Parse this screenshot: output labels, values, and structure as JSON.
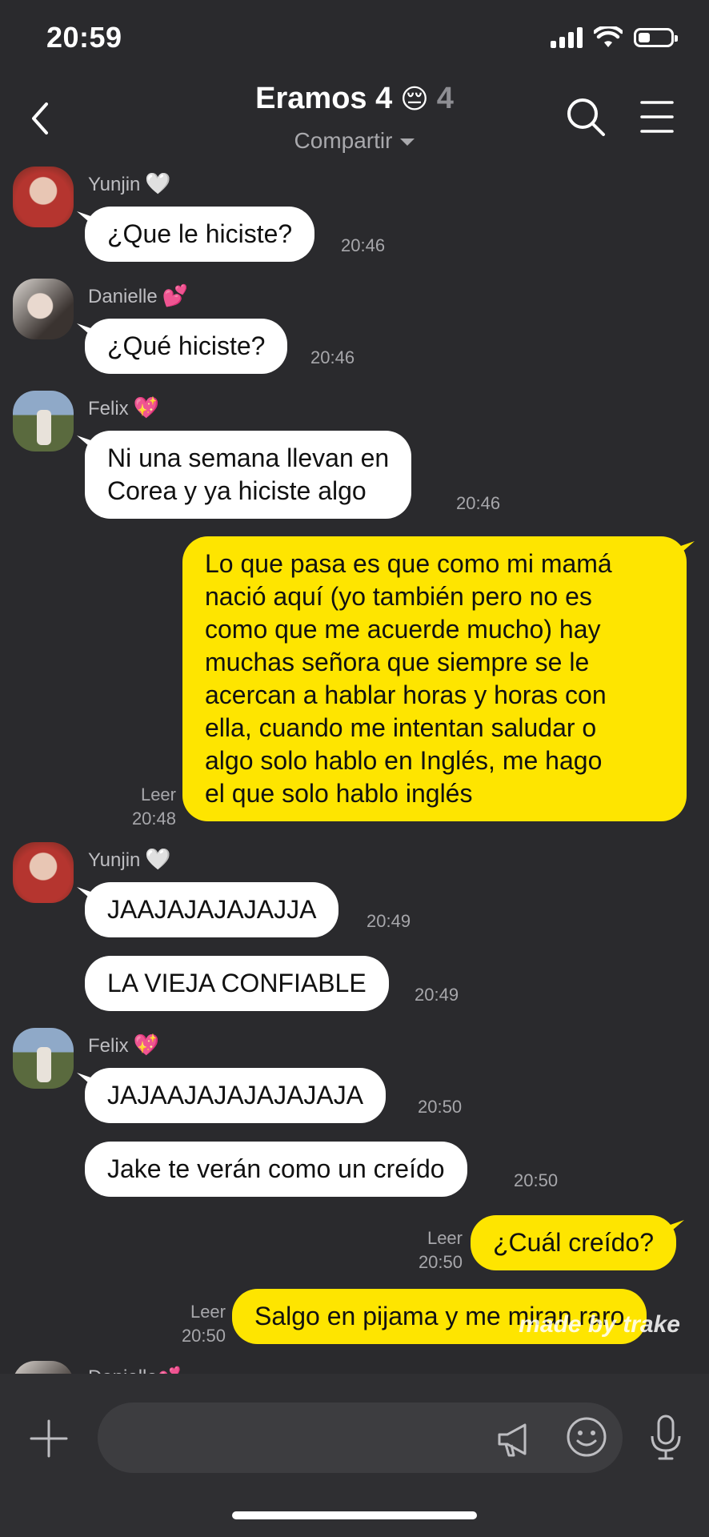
{
  "status_bar": {
    "time": "20:59"
  },
  "header": {
    "back_icon": "chevron-left-icon",
    "title": "Eramos 4",
    "title_emoji": "😔",
    "member_count": "4",
    "share_label": "Compartir",
    "search_icon": "search-icon",
    "menu_icon": "hamburger-menu-icon"
  },
  "messages": {
    "m1": {
      "sender": "Yunjin",
      "sender_emoji": "🤍",
      "text": "¿Que le hiciste?",
      "time": "20:46"
    },
    "m2": {
      "sender": "Danielle",
      "sender_emoji": "💕",
      "text": "¿Qué hiciste?",
      "time": "20:46"
    },
    "m3": {
      "sender": "Felix",
      "sender_emoji": "💖",
      "text": "Ni una semana llevan en\nCorea y ya hiciste algo",
      "time": "20:46"
    },
    "m4": {
      "text": "Lo que pasa es que como mi mamá\nnació aquí (yo también pero no es\ncomo que me acuerde mucho) hay\nmuchas señora que siempre se le\nacercan a hablar horas y horas con\nella, cuando me intentan saludar o\nalgo solo hablo en Inglés, me hago\nel que solo hablo inglés",
      "read": "Leer",
      "time": "20:48"
    },
    "m5": {
      "sender": "Yunjin",
      "sender_emoji": "🤍",
      "text": "JAAJAJAJAJAJJA",
      "time": "20:49"
    },
    "m6": {
      "text": "LA VIEJA CONFIABLE",
      "time": "20:49"
    },
    "m7": {
      "sender": "Felix",
      "sender_emoji": "💖",
      "text": "JAJAAJAJAJAJAJAJA",
      "time": "20:50"
    },
    "m8": {
      "text": "Jake te verán como un creído",
      "time": "20:50"
    },
    "m9": {
      "text": "¿Cuál creído?",
      "read": "Leer",
      "time": "20:50"
    },
    "m10": {
      "text": "Salgo en pijama y me miran raro",
      "read": "Leer",
      "time": "20:50"
    },
    "watermark": "made by trake",
    "next_sender": "Danielle",
    "next_sender_emoji": "💕"
  },
  "input_bar": {
    "plus_icon": "plus-icon",
    "placeholder": "",
    "megaphone_icon": "megaphone-icon",
    "emoji_icon": "smiley-icon",
    "mic_icon": "microphone-icon"
  },
  "colors": {
    "background": "#2a2a2d",
    "incoming_bubble": "#ffffff",
    "outgoing_bubble": "#fee500"
  }
}
